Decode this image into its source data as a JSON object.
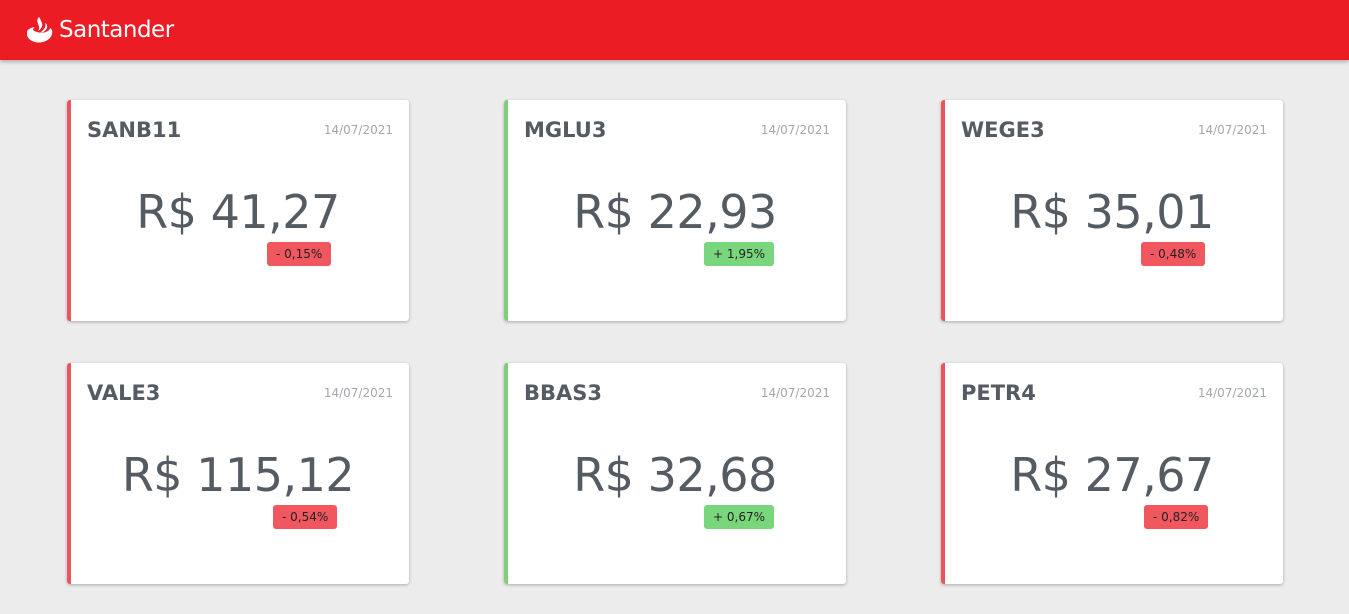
{
  "header": {
    "brand": "Santander",
    "logo_icon": "santander-flame-icon",
    "background_color": "#ec1c24"
  },
  "colors": {
    "down": "#f0575f",
    "up": "#7ad67c",
    "text": "#555b62"
  },
  "cards": [
    {
      "ticker": "SANB11",
      "date": "14/07/2021",
      "price": "R$ 41,27",
      "change": "- 0,15%",
      "trend": "down"
    },
    {
      "ticker": "MGLU3",
      "date": "14/07/2021",
      "price": "R$ 22,93",
      "change": "+ 1,95%",
      "trend": "up"
    },
    {
      "ticker": "WEGE3",
      "date": "14/07/2021",
      "price": "R$ 35,01",
      "change": "- 0,48%",
      "trend": "down"
    },
    {
      "ticker": "VALE3",
      "date": "14/07/2021",
      "price": "R$ 115,12",
      "change": "- 0,54%",
      "trend": "down"
    },
    {
      "ticker": "BBAS3",
      "date": "14/07/2021",
      "price": "R$ 32,68",
      "change": "+ 0,67%",
      "trend": "up"
    },
    {
      "ticker": "PETR4",
      "date": "14/07/2021",
      "price": "R$ 27,67",
      "change": "- 0,82%",
      "trend": "down"
    }
  ]
}
